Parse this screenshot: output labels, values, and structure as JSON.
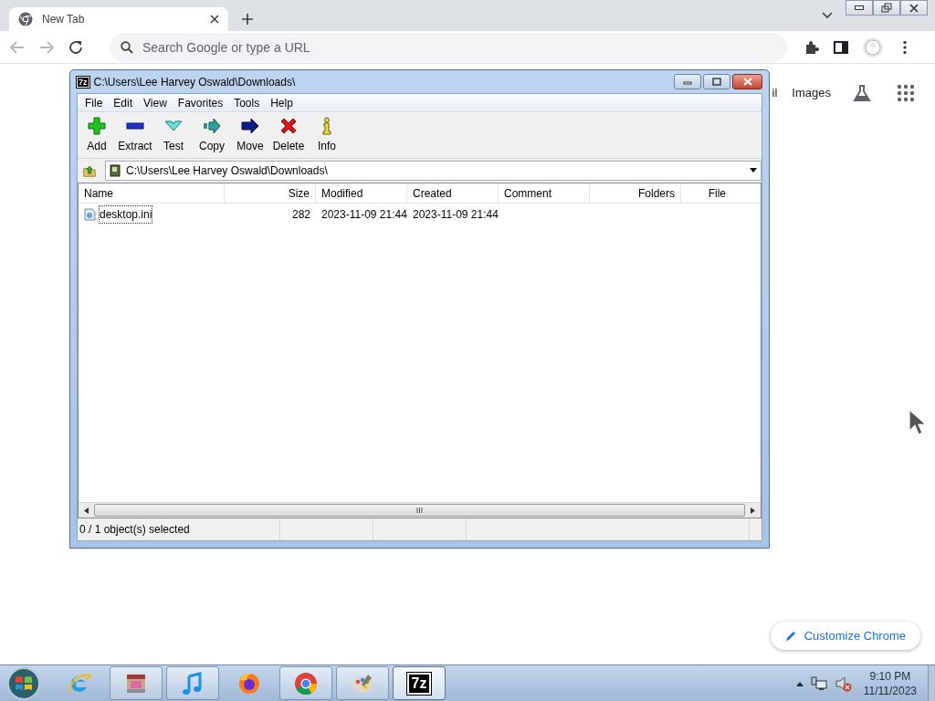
{
  "browser": {
    "tabs": [
      {
        "title": "New Tab",
        "selected": true
      }
    ],
    "omnibox": {
      "placeholder": "Search Google or type a URL"
    },
    "ntp_links": [
      "il",
      "Images"
    ],
    "customize_button": "Customize Chrome"
  },
  "app_window": {
    "icon_text": "7z",
    "title": "C:\\Users\\Lee Harvey Oswald\\Downloads\\",
    "menu": [
      "File",
      "Edit",
      "View",
      "Favorites",
      "Tools",
      "Help"
    ],
    "toolbar": [
      {
        "label": "Add",
        "kind": "add"
      },
      {
        "label": "Extract",
        "kind": "extract"
      },
      {
        "label": "Test",
        "kind": "test"
      },
      {
        "label": "Copy",
        "kind": "copy"
      },
      {
        "label": "Move",
        "kind": "move"
      },
      {
        "label": "Delete",
        "kind": "delete"
      },
      {
        "label": "Info",
        "kind": "info"
      }
    ],
    "address": "C:\\Users\\Lee Harvey Oswald\\Downloads\\",
    "columns": [
      "Name",
      "Size",
      "Modified",
      "Created",
      "Comment",
      "Folders",
      "File"
    ],
    "rows": [
      {
        "name": "desktop.ini",
        "size": "282",
        "modified": "2023-11-09 21:44",
        "created": "2023-11-09 21:44",
        "focused": true
      }
    ],
    "status": "0 / 1 object(s) selected"
  },
  "taskbar": {
    "apps": [
      {
        "kind": "ie",
        "running": false,
        "active": false
      },
      {
        "kind": "archive",
        "running": true,
        "active": false
      },
      {
        "kind": "music",
        "running": true,
        "active": false
      },
      {
        "kind": "firefox",
        "running": false,
        "active": false
      },
      {
        "kind": "chrome",
        "running": true,
        "active": false
      },
      {
        "kind": "paint",
        "running": true,
        "active": false
      },
      {
        "kind": "sevenzip",
        "icon_text": "7z",
        "running": true,
        "active": true
      }
    ],
    "clock": {
      "time": "9:10 PM",
      "date": "11/11/2023"
    }
  }
}
